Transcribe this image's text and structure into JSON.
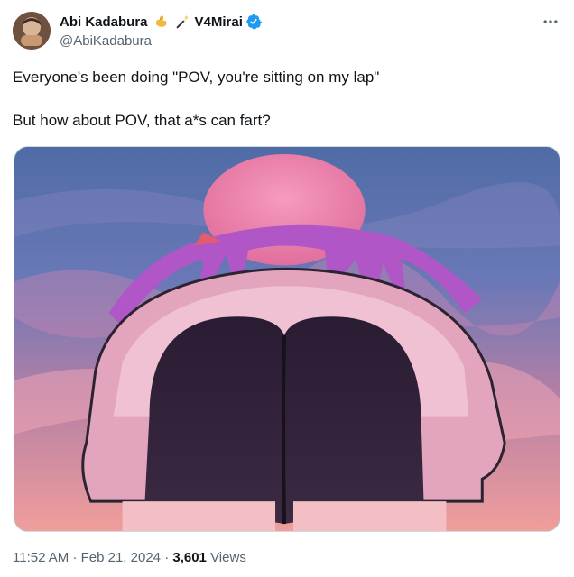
{
  "author": {
    "display_name": "Abi Kadabura",
    "secondary_name": "V4Mirai",
    "handle": "@AbiKadabura",
    "verified": true,
    "emojis": [
      "flexed-biceps-icon",
      "magic-wand-icon"
    ]
  },
  "tweet": {
    "lines": [
      "Everyone's been doing \"POV, you're sitting on my lap\"",
      "But how about POV, that a*s can fart?"
    ],
    "media": {
      "type": "image",
      "description": ""
    }
  },
  "meta": {
    "time": "11:52 AM",
    "separator": "·",
    "date": "Feb 21, 2024",
    "views_count": "3,601",
    "views_label": "Views"
  },
  "colors": {
    "text": "#0f1419",
    "secondary": "#536471",
    "verified": "#1d9bf0",
    "border": "#cfd9de"
  }
}
